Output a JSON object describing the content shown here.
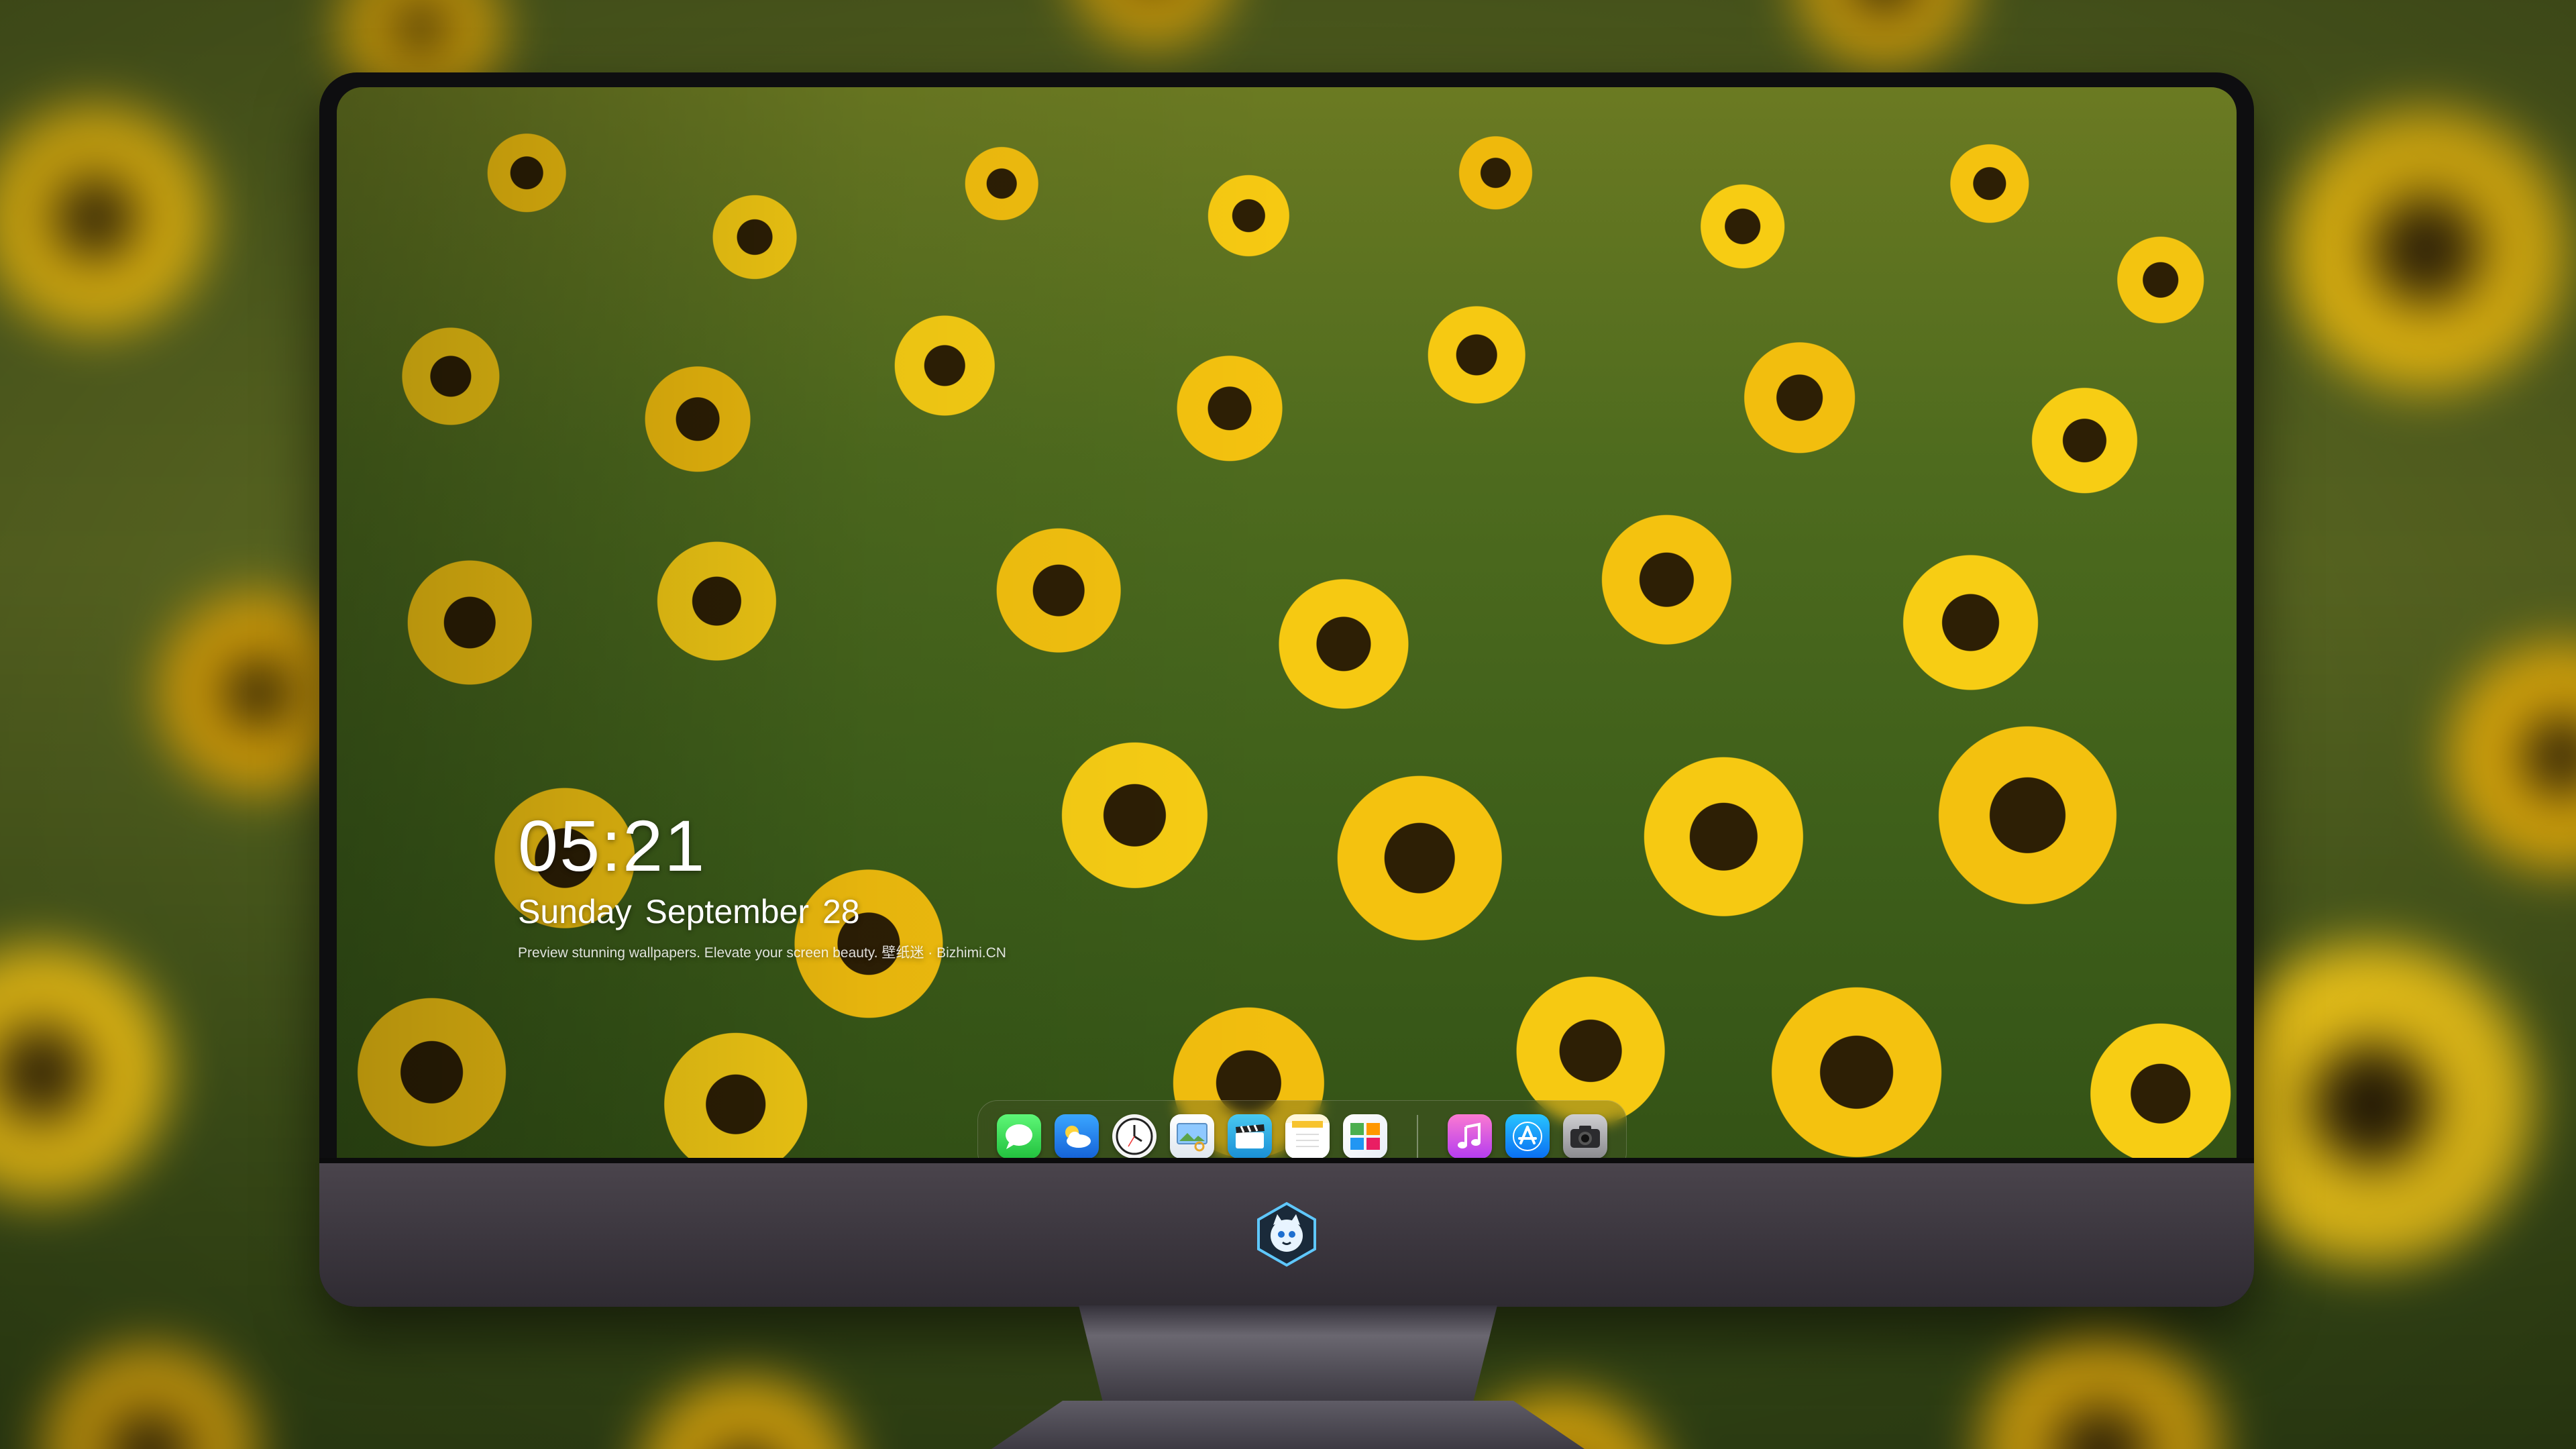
{
  "lock_screen": {
    "time": "05:21",
    "date": "Sunday September  28",
    "caption": "Preview stunning wallpapers. Elevate your screen beauty. 壁纸迷 · Bizhimi.CN"
  },
  "dock": {
    "apps": [
      {
        "name": "Messages",
        "icon": "messages-icon"
      },
      {
        "name": "Weather",
        "icon": "weather-icon"
      },
      {
        "name": "Clock",
        "icon": "clock-icon"
      },
      {
        "name": "Preview",
        "icon": "preview-icon"
      },
      {
        "name": "Clips",
        "icon": "video-clapper-icon"
      },
      {
        "name": "Notes",
        "icon": "notes-icon"
      },
      {
        "name": "Photos",
        "icon": "photos-icon"
      },
      {
        "name": "Music",
        "icon": "music-icon"
      },
      {
        "name": "App Store",
        "icon": "app-store-icon"
      },
      {
        "name": "Camera",
        "icon": "camera-icon"
      }
    ]
  },
  "monitor": {
    "logo": "bizhimi-mascot-logo"
  },
  "colors": {
    "bezel": "#0e0e10",
    "chin": "#3b363e",
    "sunflower_yellow": "#f4c20f",
    "leaf_green": "#4e6b1e"
  }
}
